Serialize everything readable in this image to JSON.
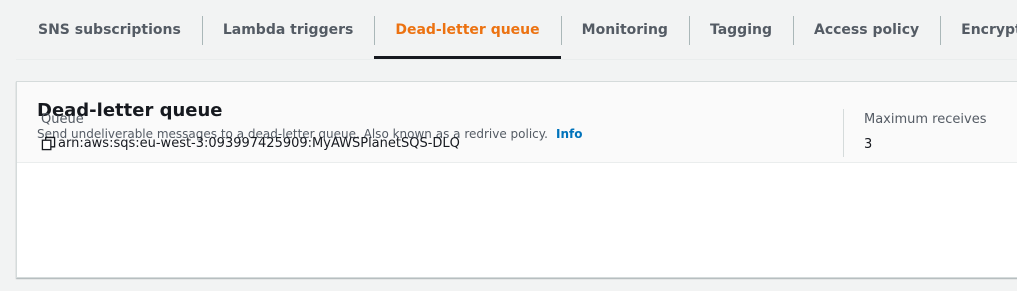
{
  "tabs": [
    {
      "label": "SNS subscriptions",
      "active": false
    },
    {
      "label": "Lambda triggers",
      "active": false
    },
    {
      "label": "Dead-letter queue",
      "active": true
    },
    {
      "label": "Monitoring",
      "active": false
    },
    {
      "label": "Tagging",
      "active": false
    },
    {
      "label": "Access policy",
      "active": false
    },
    {
      "label": "Encryption",
      "active": false
    }
  ],
  "panel": {
    "title": "Dead-letter queue",
    "description": "Send undeliverable messages to a dead-letter queue. Also known as a redrive policy.",
    "info_link": "Info",
    "queue": {
      "label": "Queue",
      "value": "arn:aws:sqs:eu-west-3:093997425909:MyAWSPlanetSQS-DLQ",
      "icon": "copy-icon"
    },
    "max_receives": {
      "label": "Maximum receives",
      "value": "3"
    }
  },
  "colors": {
    "active_tab": "#ec7211",
    "link": "#0073bb",
    "text": "#16191f",
    "muted_text": "#545b64"
  }
}
